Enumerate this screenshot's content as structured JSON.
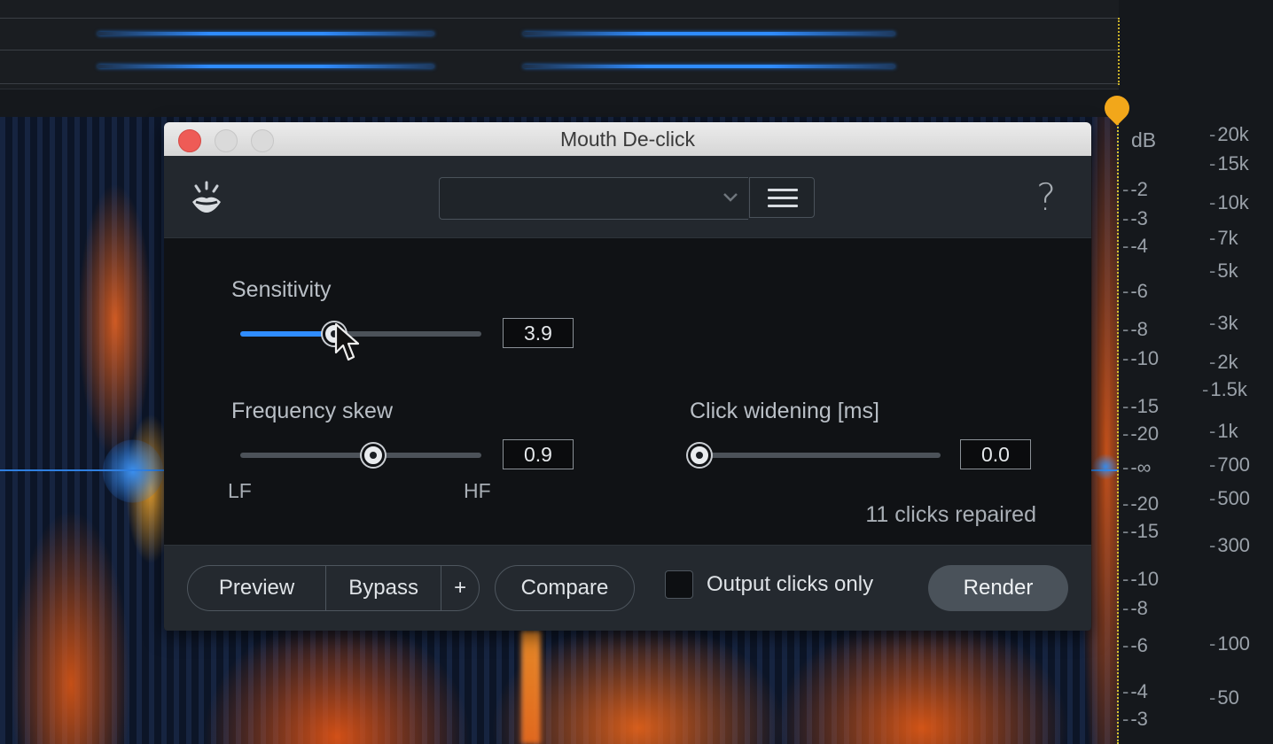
{
  "window": {
    "title": "Mouth De-click"
  },
  "toolbar": {
    "preset_value": "",
    "logo_icon": "mouth-click-logo-icon",
    "menu_icon": "hamburger-menu-icon",
    "help_label": "?"
  },
  "controls": {
    "sensitivity": {
      "label": "Sensitivity",
      "value": "3.9",
      "position": 0.39
    },
    "frequency_skew": {
      "label": "Frequency skew",
      "value": "0.9",
      "position": 0.55,
      "low_label": "LF",
      "high_label": "HF"
    },
    "click_widening": {
      "label": "Click widening [ms]",
      "value": "0.0",
      "position": 0.0
    }
  },
  "status": {
    "text": "11 clicks repaired"
  },
  "footer": {
    "preview_label": "Preview",
    "bypass_label": "Bypass",
    "plus_label": "+",
    "compare_label": "Compare",
    "output_clicks_only_label": "Output clicks only",
    "output_clicks_only_checked": false,
    "render_label": "Render"
  },
  "db_scale": {
    "title": "dB",
    "ticks": [
      "-2",
      "-3",
      "-4",
      "-6",
      "-8",
      "-10",
      "-15",
      "-20",
      "-∞",
      "-20",
      "-15",
      "-10",
      "-8",
      "-6",
      "-4",
      "-3"
    ]
  },
  "hz_scale": {
    "ticks": [
      "20k",
      "15k",
      "10k",
      "7k",
      "5k",
      "3k",
      "2k",
      "1.5k",
      "1k",
      "700",
      "500",
      "300",
      "100",
      "50"
    ]
  },
  "colors": {
    "accent": "#2f8cff",
    "playhead": "#f2a71a",
    "close_button": "#ee5b56"
  }
}
